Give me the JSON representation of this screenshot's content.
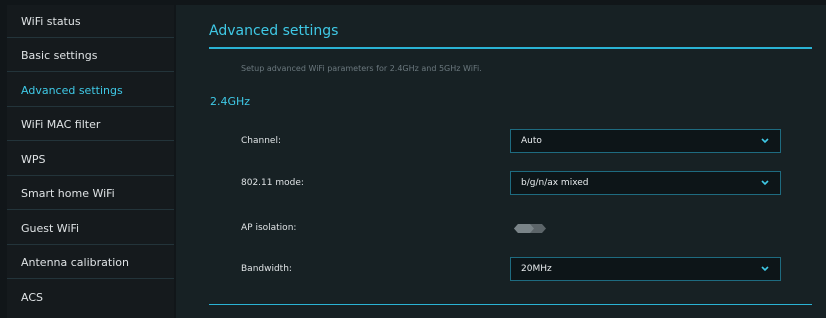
{
  "sidebar": {
    "items": [
      {
        "label": "WiFi status"
      },
      {
        "label": "Basic settings"
      },
      {
        "label": "Advanced settings"
      },
      {
        "label": "WiFi MAC filter"
      },
      {
        "label": "WPS"
      },
      {
        "label": "Smart home WiFi"
      },
      {
        "label": "Guest WiFi"
      },
      {
        "label": "Antenna calibration"
      },
      {
        "label": "ACS"
      }
    ],
    "active_item": "Advanced settings"
  },
  "main": {
    "title": "Advanced settings",
    "description": "Setup advanced WiFi parameters for 2.4GHz and 5GHz WiFi.",
    "section": "2.4GHz",
    "fields": {
      "channel": {
        "label": "Channel:",
        "value": "Auto"
      },
      "mode": {
        "label": "802.11 mode:",
        "value": "b/g/n/ax mixed"
      },
      "ap_isolation": {
        "label": "AP isolation:",
        "state": "off"
      },
      "bandwidth": {
        "label": "Bandwidth:",
        "value": "20MHz"
      }
    }
  },
  "colors": {
    "accent": "#3fc9e6",
    "sidebar_bg": "#151a1d",
    "panel_bg": "#172124",
    "select_border": "#1e6b80"
  },
  "icons": {
    "select_arrow": "chevron-down-icon",
    "toggle": "toggle-switch"
  }
}
